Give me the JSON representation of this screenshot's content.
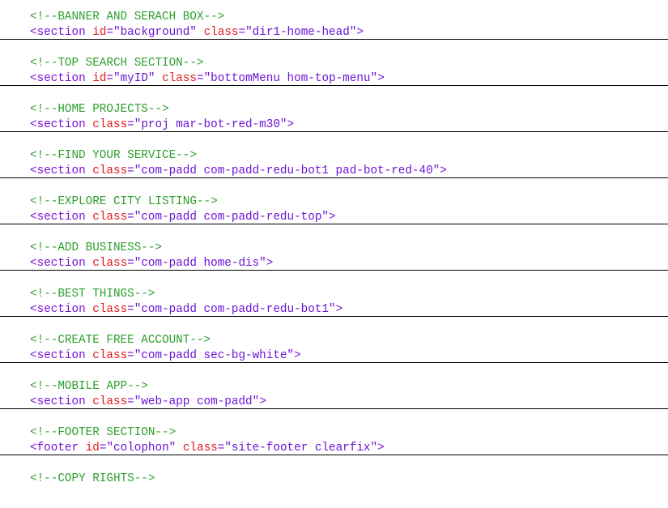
{
  "blocks": [
    {
      "comment": "<!--BANNER AND SERACH BOX-->",
      "tag": "section",
      "attrs": [
        {
          "name": "id",
          "value": "\"background\""
        },
        {
          "name": "class",
          "value": "\"dir1-home-head\""
        }
      ]
    },
    {
      "comment": "<!--TOP SEARCH SECTION-->",
      "tag": "section",
      "attrs": [
        {
          "name": "id",
          "value": "\"myID\""
        },
        {
          "name": "class",
          "value": "\"bottomMenu hom-top-menu\""
        }
      ]
    },
    {
      "comment": "<!--HOME PROJECTS-->",
      "tag": "section",
      "attrs": [
        {
          "name": "class",
          "value": "\"proj mar-bot-red-m30\""
        }
      ]
    },
    {
      "comment": "<!--FIND YOUR SERVICE-->",
      "tag": "section",
      "attrs": [
        {
          "name": "class",
          "value": "\"com-padd com-padd-redu-bot1 pad-bot-red-40\""
        }
      ]
    },
    {
      "comment": "<!--EXPLORE CITY LISTING-->",
      "tag": "section",
      "attrs": [
        {
          "name": "class",
          "value": "\"com-padd com-padd-redu-top\""
        }
      ]
    },
    {
      "comment": "<!--ADD BUSINESS-->",
      "tag": "section",
      "attrs": [
        {
          "name": "class",
          "value": "\"com-padd home-dis\""
        }
      ]
    },
    {
      "comment": "<!--BEST THINGS-->",
      "tag": "section",
      "attrs": [
        {
          "name": "class",
          "value": "\"com-padd com-padd-redu-bot1\""
        }
      ]
    },
    {
      "comment": "<!--CREATE FREE ACCOUNT-->",
      "tag": "section",
      "attrs": [
        {
          "name": "class",
          "value": "\"com-padd sec-bg-white\""
        }
      ]
    },
    {
      "comment": "<!--MOBILE APP-->",
      "tag": "section",
      "attrs": [
        {
          "name": "class",
          "value": "\"web-app com-padd\""
        }
      ]
    },
    {
      "comment": "<!--FOOTER SECTION-->",
      "tag": "footer",
      "attrs": [
        {
          "name": "id",
          "value": "\"colophon\""
        },
        {
          "name": "class",
          "value": "\"site-footer clearfix\""
        }
      ]
    },
    {
      "comment": "<!--COPY RIGHTS-->",
      "tag": "",
      "attrs": []
    }
  ],
  "syntax_colors": {
    "comment": "#2e9f2e",
    "tag": "#7a10d8",
    "attribute_name": "#e0191d",
    "attribute_value": "#6b14d6",
    "rule": "#000000"
  }
}
